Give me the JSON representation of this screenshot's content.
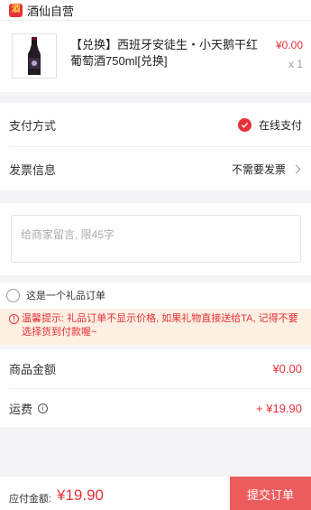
{
  "store": {
    "logo_char": "酒",
    "name": "酒仙自营"
  },
  "product": {
    "title": "【兑换】西班牙安徒生・小天鹅干红葡萄酒750ml[兑换]",
    "price": "¥0.00",
    "quantity": "x 1",
    "image_icon": "wine-bottle-icon"
  },
  "payment": {
    "label": "支付方式",
    "value": "在线支付",
    "selected_icon": "check-circle-icon"
  },
  "invoice": {
    "label": "发票信息",
    "value": "不需要发票"
  },
  "message": {
    "placeholder": "给商家留言, 限45字",
    "value": ""
  },
  "gift": {
    "label": "这是一个礼品订单",
    "checked": false,
    "tip": "温馨提示: 礼品订单不显示价格, 如果礼物直接送给TA, 记得不要选择货到付款喔~"
  },
  "amounts": {
    "goods_label": "商品金额",
    "goods_value": "¥0.00",
    "shipping_label": "运费",
    "shipping_value": "+ ¥19.90"
  },
  "footer": {
    "pay_label": "应付金额:",
    "pay_amount": "¥19.90",
    "submit_label": "提交订单"
  },
  "colors": {
    "accent": "#e8303a",
    "submit_button": "#ec5c5c",
    "tip_background": "#fdf0e2",
    "page_background": "#f4f4f6"
  }
}
